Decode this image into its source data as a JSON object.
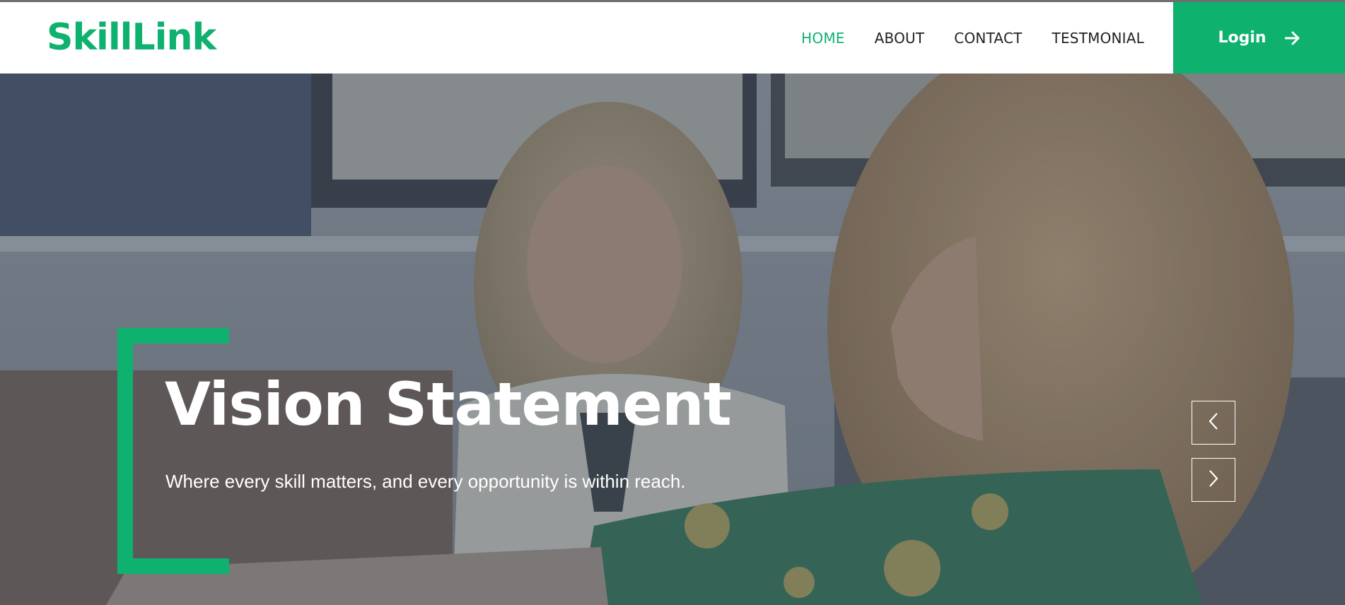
{
  "brand": {
    "name": "SkillLink"
  },
  "nav": {
    "items": [
      {
        "label": "HOME",
        "active": true
      },
      {
        "label": "ABOUT",
        "active": false
      },
      {
        "label": "CONTACT",
        "active": false
      },
      {
        "label": "TESTMONIAL",
        "active": false
      }
    ]
  },
  "login": {
    "label": "Login",
    "icon": "arrow-right-icon"
  },
  "hero": {
    "title": "Vision Statement",
    "subtitle": "Where every skill matters, and every opportunity is within reach.",
    "prev_icon": "chevron-left-icon",
    "next_icon": "chevron-right-icon"
  },
  "colors": {
    "accent": "#0fb16f",
    "nav_text": "#222222",
    "overlay": "#6b7683"
  }
}
